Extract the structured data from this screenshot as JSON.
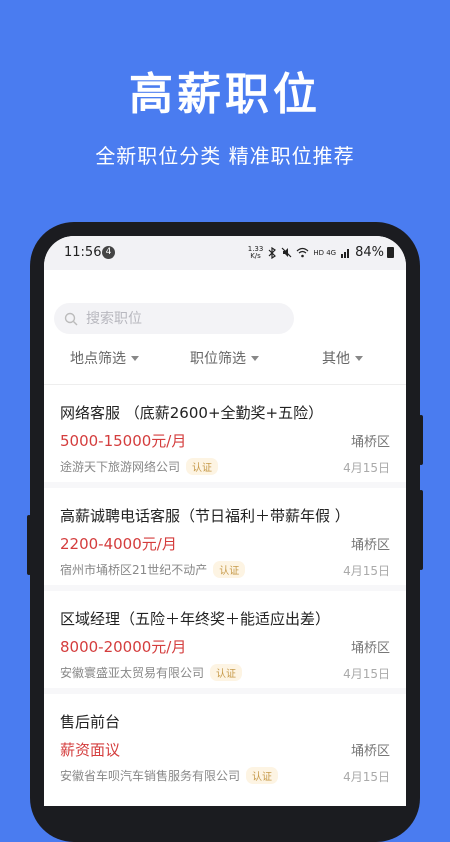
{
  "hero": {
    "title": "高薪职位",
    "subtitle": "全新职位分类  精准职位推荐"
  },
  "status_bar": {
    "time": "11:56",
    "notification_count": "4",
    "speed_value": "1.33",
    "speed_unit": "K/s",
    "battery": "84%",
    "signal_text": "HD 4G"
  },
  "search": {
    "placeholder": "搜索职位"
  },
  "filters": [
    {
      "label": "地点筛选"
    },
    {
      "label": "职位筛选"
    },
    {
      "label": "其他"
    }
  ],
  "jobs": [
    {
      "title": "网络客服 （底薪2600+全勤奖+五险）",
      "salary": "5000-15000元/月",
      "location": "埇桥区",
      "company": "途游天下旅游网络公司",
      "badge": "认证",
      "date": "4月15日"
    },
    {
      "title": "高薪诚聘电话客服（节日福利＋带薪年假 ）",
      "salary": "2200-4000元/月",
      "location": "埇桥区",
      "company": "宿州市埇桥区21世纪不动产",
      "badge": "认证",
      "date": "4月15日"
    },
    {
      "title": "区域经理（五险＋年终奖＋能适应出差）",
      "salary": "8000-20000元/月",
      "location": "埇桥区",
      "company": "安徽寰盛亚太贸易有限公司",
      "badge": "认证",
      "date": "4月15日"
    },
    {
      "title": "售后前台",
      "salary": "薪资面议",
      "location": "埇桥区",
      "company": "安徽省车呗汽车销售服务有限公司",
      "badge": "认证",
      "date": "4月15日"
    }
  ],
  "colors": {
    "background": "#4a7cf0",
    "salary": "#d43d3d",
    "badge": "#c69a4a"
  }
}
